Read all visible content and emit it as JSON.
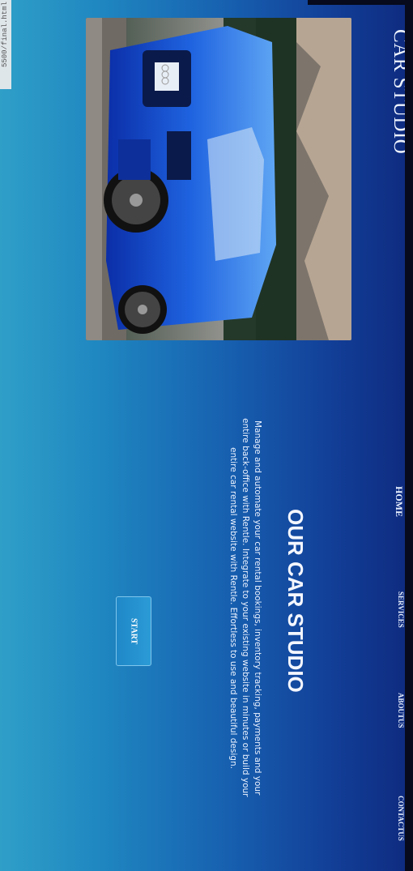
{
  "browser": {
    "url_fragment": "5500/final.html"
  },
  "header": {
    "brand": "CAR STUDIO"
  },
  "nav": {
    "items": [
      {
        "label": "HOME"
      },
      {
        "label": "SERVICES"
      },
      {
        "label": "ABOUTUS"
      },
      {
        "label": "CONTACTUS"
      }
    ]
  },
  "hero": {
    "title": "OUR CAR STUDIO",
    "description": "Manage and automate your car rental bookings, inventory tracking, payments and your entire back-office with Rentle. Integrate to your existing website in minutes or build your entire car rental website with Rentle. Effortless to use and beautiful design.",
    "button_label": "START",
    "image": "blue-audi-car-photo"
  },
  "colors": {
    "gradient_light": "#2f9fc8",
    "gradient_dark": "#0e2a7e",
    "button": "#2b9bd6",
    "text": "#ffffff"
  }
}
